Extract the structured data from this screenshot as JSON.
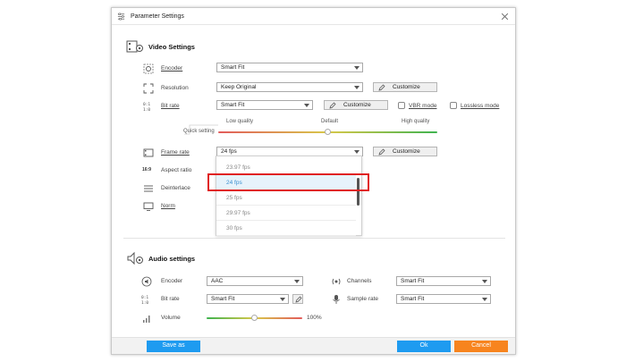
{
  "dialog": {
    "title": "Parameter Settings"
  },
  "video": {
    "section_title": "Video Settings",
    "encoder": {
      "label": "Encoder",
      "value": "Smart Fit"
    },
    "resolution": {
      "label": "Resolution",
      "value": "Keep Original",
      "button": "Customize"
    },
    "bitrate": {
      "label": "Bit rate",
      "value": "Smart Fit",
      "button": "Customize",
      "vbr_label": "VBR mode",
      "lossless_label": "Lossless mode"
    },
    "quick": {
      "label": "Quick setting",
      "low": "Low quality",
      "default": "Default",
      "high": "High quality",
      "level": 0.5
    },
    "framerate": {
      "label": "Frame rate",
      "value": "24 fps",
      "button": "Customize"
    },
    "aspect": {
      "label": "Aspect ratio",
      "icon_text": "16:9"
    },
    "deinterlace": {
      "label": "Deinterlace"
    },
    "norm": {
      "label": "Norm"
    },
    "framerate_options": [
      "23.97 fps",
      "24 fps",
      "25 fps",
      "29.97 fps",
      "30 fps"
    ],
    "framerate_selected": "24 fps"
  },
  "audio": {
    "section_title": "Audio settings",
    "encoder": {
      "label": "Encoder",
      "value": "AAC"
    },
    "bitrate": {
      "label": "Bit rate",
      "value": "Smart Fit"
    },
    "channels": {
      "label": "Channels",
      "value": "Smart Fit"
    },
    "samplerate": {
      "label": "Sample rate",
      "value": "Smart Fit"
    },
    "volume": {
      "label": "Volume",
      "value": "100%",
      "level": 0.5
    }
  },
  "footer": {
    "save_as": "Save as",
    "ok": "Ok",
    "cancel": "Cancel"
  },
  "colors": {
    "accent": "#1e9bf0",
    "cancel": "#f7841e",
    "highlight": "#e02020"
  }
}
